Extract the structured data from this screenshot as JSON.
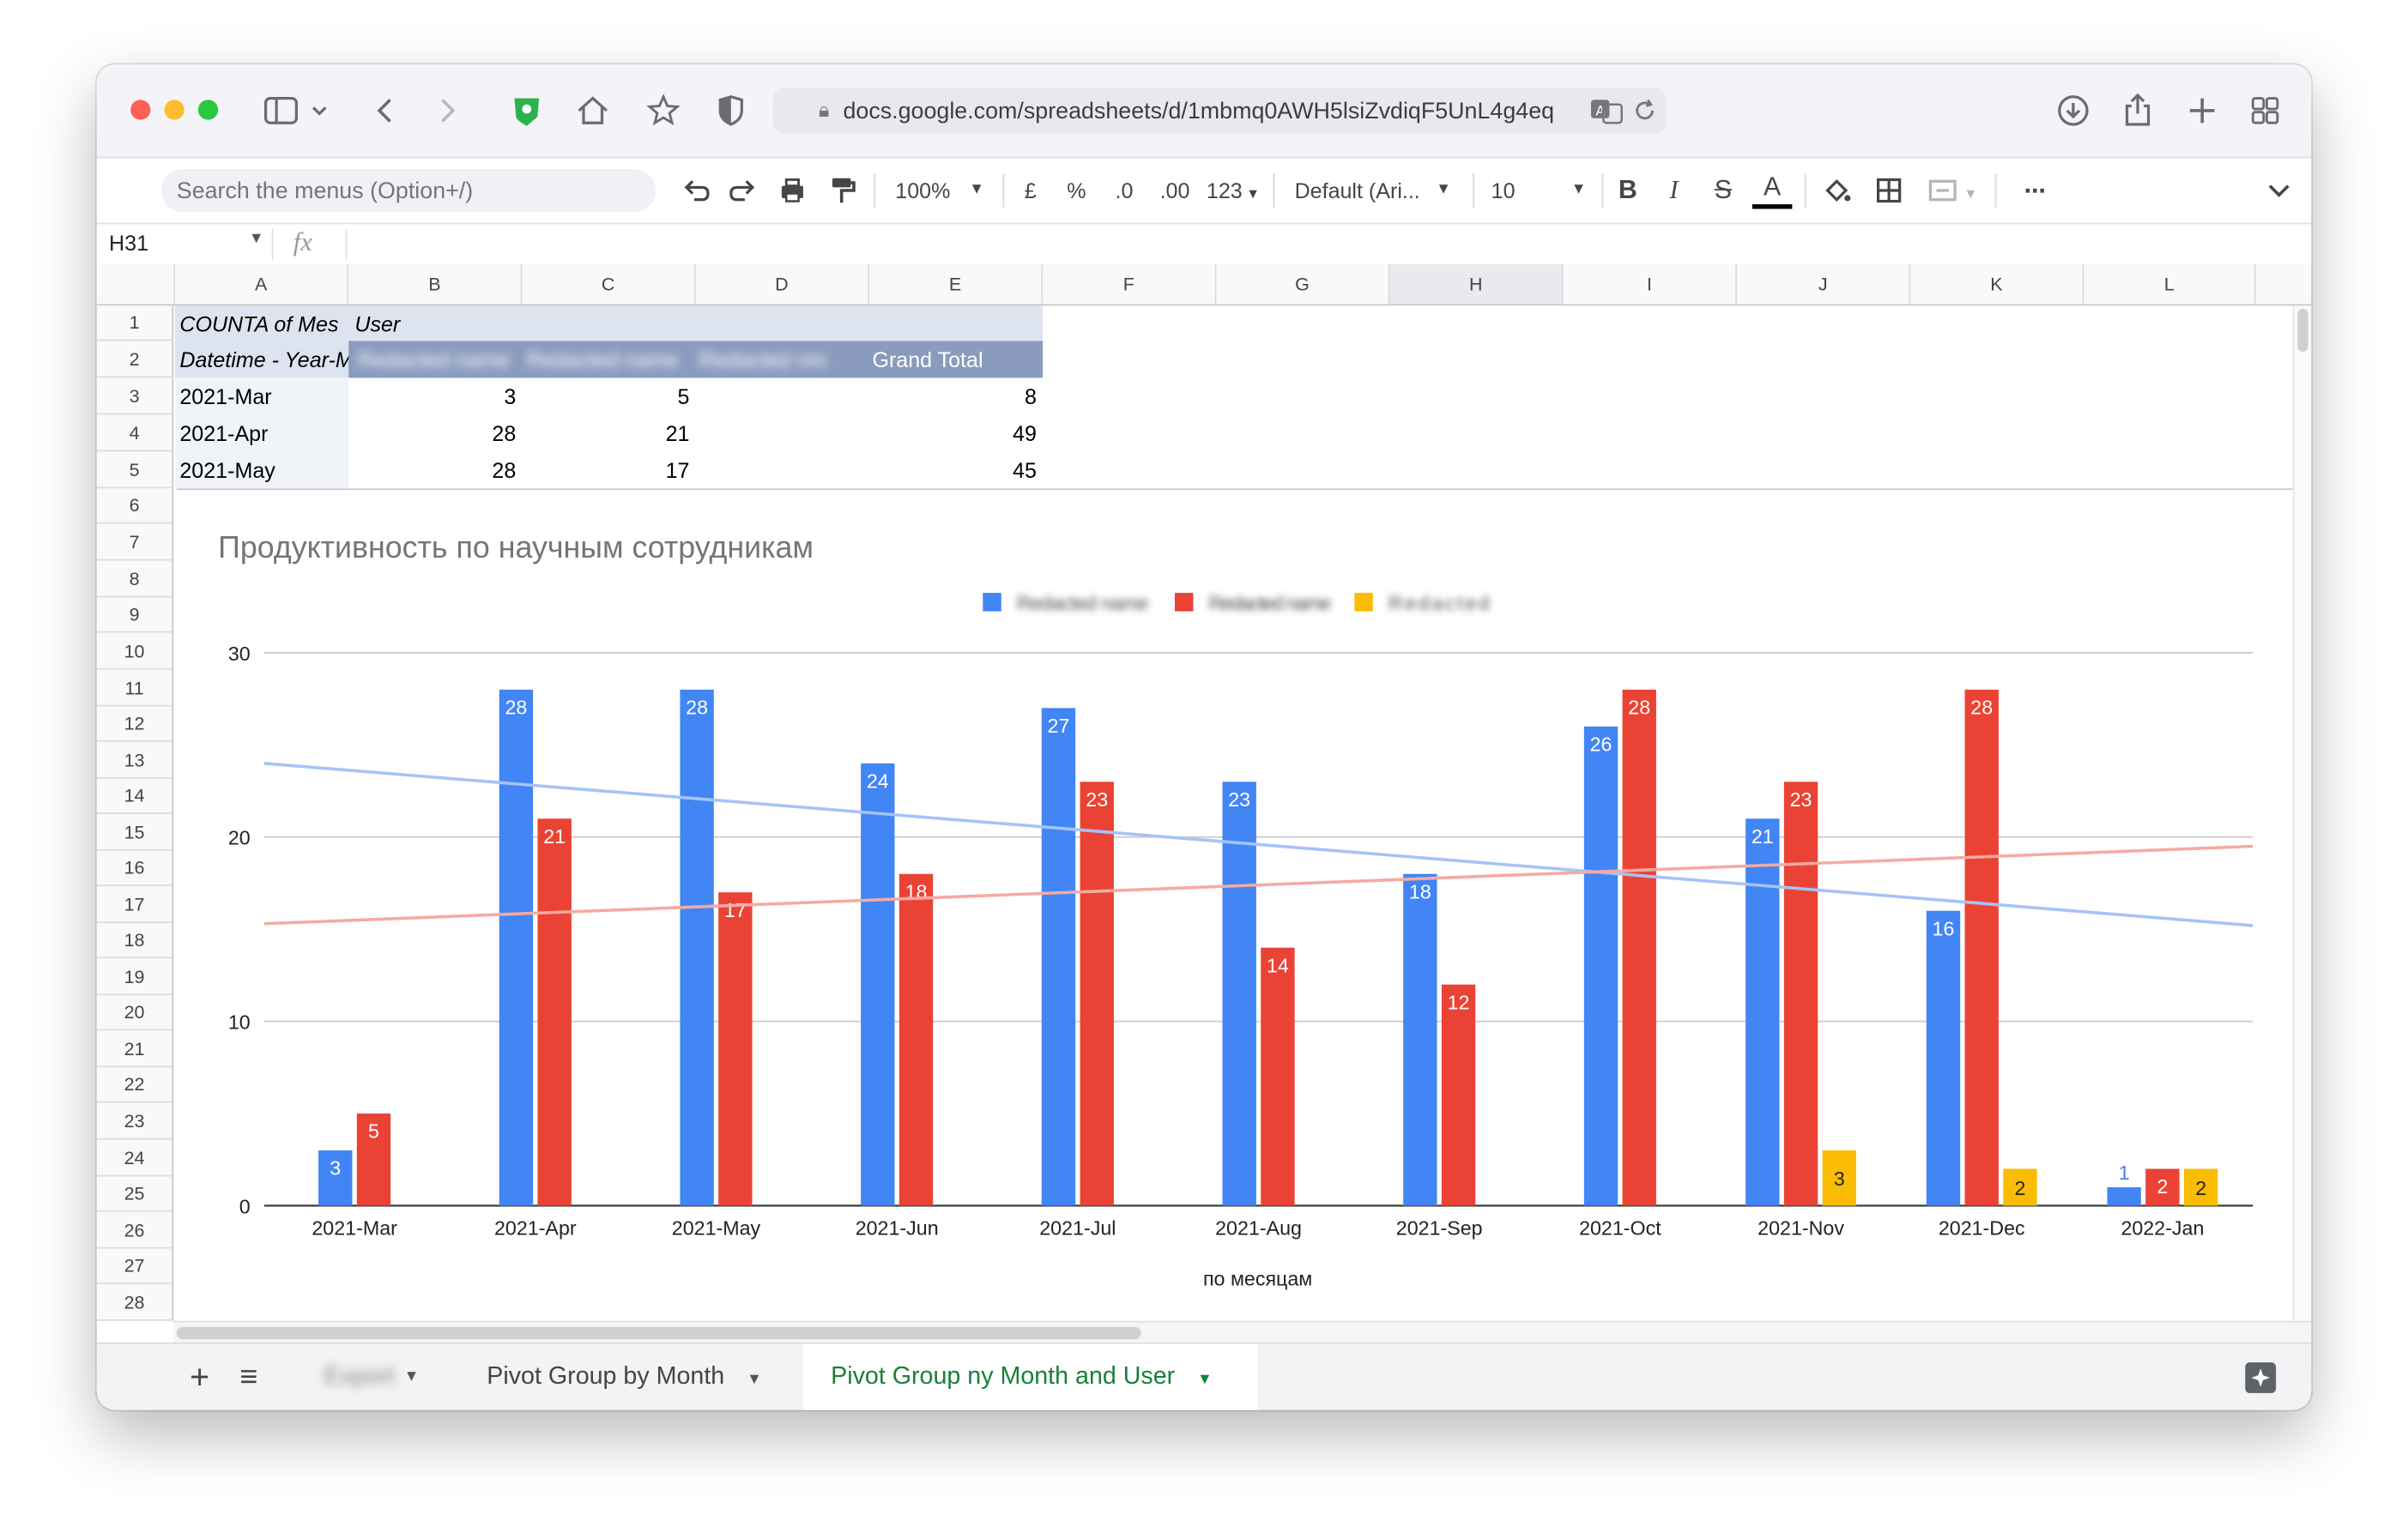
{
  "browser": {
    "url": "docs.google.com/spreadsheets/d/1mbmq0AWH5lsiZvdiqF5UnL4g4eq"
  },
  "toolbar": {
    "menu_search_placeholder": "Search the menus (Option+/)",
    "zoom": "100%",
    "currency": "£",
    "percent": "%",
    "decrease_decimals": ".0",
    "increase_decimals": ".00",
    "more_formats": "123",
    "font": "Default (Ari...",
    "font_size": "10",
    "bold": "B",
    "italic": "I",
    "strikethrough": "S",
    "text_color": "A",
    "more": "⋯"
  },
  "formula_bar": {
    "cell_ref": "H31",
    "fx": "fx",
    "value": ""
  },
  "grid": {
    "columns": [
      "A",
      "B",
      "C",
      "D",
      "E",
      "F",
      "G",
      "H",
      "I",
      "J",
      "K",
      "L"
    ],
    "rows": [
      "1",
      "2",
      "3",
      "4",
      "5",
      "6",
      "7",
      "8",
      "9",
      "10",
      "11",
      "12",
      "13",
      "14",
      "15",
      "16",
      "17",
      "18",
      "19",
      "20",
      "21",
      "22",
      "23",
      "24",
      "25",
      "26",
      "27",
      "28"
    ],
    "pivot": {
      "a1": "COUNTA of Mes",
      "b1": "User",
      "a2": "Datetime - Year-Month",
      "hidden_header_1": "Redacted name",
      "hidden_header_2": "Redacted name",
      "hidden_header_3": "Redacted nm",
      "grand_total": "Grand Total",
      "data_rows": [
        {
          "label": "2021-Mar",
          "b": "3",
          "c": "5",
          "d": "",
          "e": "8"
        },
        {
          "label": "2021-Apr",
          "b": "28",
          "c": "21",
          "d": "",
          "e": "49"
        },
        {
          "label": "2021-May",
          "b": "28",
          "c": "17",
          "d": "",
          "e": "45"
        }
      ]
    }
  },
  "chart_data": {
    "type": "bar",
    "title": "Продуктивность по научным сотрудникам",
    "xlabel": "по месяцам",
    "ylabel": "",
    "ylim": [
      0,
      30
    ],
    "yticks": [
      "0",
      "10",
      "20",
      "30"
    ],
    "grid": true,
    "legend": "top",
    "categories": [
      "2021-Mar",
      "2021-Apr",
      "2021-May",
      "2021-Jun",
      "2021-Jul",
      "2021-Aug",
      "2021-Sep",
      "2021-Oct",
      "2021-Nov",
      "2021-Dec",
      "2022-Jan"
    ],
    "series": [
      {
        "legend_text": "Redacted name",
        "color": "#4285f4",
        "values": [
          3,
          28,
          28,
          24,
          27,
          23,
          18,
          26,
          21,
          16,
          1
        ]
      },
      {
        "legend_text": "Redacted name",
        "color": "#ea4335",
        "values": [
          5,
          21,
          17,
          18,
          23,
          14,
          12,
          28,
          23,
          28,
          2
        ]
      },
      {
        "legend_text": "Redacted",
        "color": "#fbbc04",
        "values": [
          null,
          null,
          null,
          null,
          null,
          null,
          null,
          null,
          3,
          2,
          2
        ]
      }
    ],
    "trendlines": [
      {
        "color": "#a6c3f8",
        "start": 24,
        "end": 15.2
      },
      {
        "color": "#f4aaa3",
        "start": 15.3,
        "end": 19.5
      }
    ]
  },
  "tabs": {
    "add": "+",
    "list": "≡",
    "items": [
      {
        "label": "Export",
        "active": false
      },
      {
        "label": "Pivot Group by Month",
        "active": false
      },
      {
        "label": "Pivot Group ny Month and User",
        "active": true
      }
    ]
  }
}
